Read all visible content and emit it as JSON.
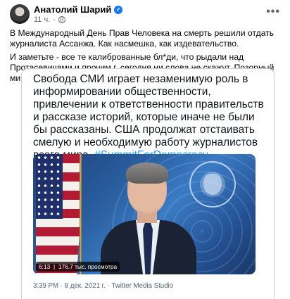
{
  "post": {
    "author": "Анатолий Шарий",
    "time": "11 ч.",
    "paragraph1": "В Международный День Прав Человека на смерть решили отдать журналиста Ассанжа. Как насмешка, как издевательство.",
    "paragraph2": "И заметьте - все те калиброванные бл*ди, что рыдали над Протасевичами и прочим г, сегодня ни слова не скажут. Позорный мир."
  },
  "tweet": {
    "text": "Свобода СМИ играет незаменимую роль в информировании общественности, привлечении к ответственности правительств и рассказе историй, которые иначе не были бы рассказаны. США продолжат отстаивать смелую и необходимую работу журналистов всего мира.",
    "hashtag": "#SummitForDemocracy",
    "video_duration": "6:13",
    "video_views": "176,7 тыс. просмотра",
    "timestamp": "3:39 PM · 8 дек. 2021 г. · Twitter Media Studio"
  },
  "icons": {
    "verified": "verified-check-icon",
    "privacy": "globe-icon",
    "options": "more-options-icon"
  },
  "colors": {
    "verified": "#1877f2",
    "hashtag": "#1d9bf0",
    "secondary_text": "#65676b"
  }
}
